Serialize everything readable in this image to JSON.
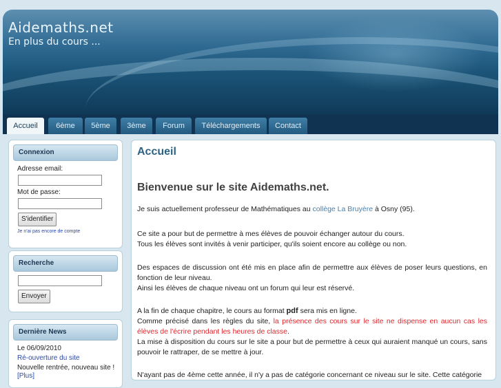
{
  "header": {
    "site_title": "Aidemaths.net",
    "slogan": "En plus du cours ..."
  },
  "nav": {
    "tabs": [
      "Accueil",
      "6ème",
      "5ème",
      "3ème",
      "Forum",
      "Téléchargements",
      "Contact"
    ]
  },
  "sidebar": {
    "connexion": {
      "title": "Connexion",
      "email_label": "Adresse email:",
      "email_value": "",
      "password_label": "Mot de passe:",
      "password_value": "",
      "login_button": "S'identifier",
      "signup_link": "Je n'ai pas encore de compte"
    },
    "recherche": {
      "title": "Recherche",
      "query_value": "",
      "search_button": "Envoyer"
    },
    "news": {
      "title": "Dernière News",
      "date_line": "Le 06/09/2010",
      "headline": "Ré-ouverture du site",
      "summary": "Nouvelle rentrée, nouveau site !",
      "more_link": "[Plus]"
    }
  },
  "main": {
    "title": "Accueil",
    "welcome": "Bienvenue sur le site Aidemaths.net.",
    "p1_before": "Je suis actuellement professeur de Mathématiques au ",
    "p1_link": "collège La Bruyère",
    "p1_after": " à Osny (95).",
    "p2_line1": "Ce site a pour but de permettre à mes élèves de pouvoir échanger autour du cours.",
    "p2_line2": "Tous les élèves sont invités à venir participer, qu'ils soient encore au collège ou non.",
    "p3_line1": "Des espaces de discussion ont été mis en place afin de permettre aux élèves de poser leurs questions, en fonction de leur niveau.",
    "p3_line2": "Ainsi les élèves de chaque niveau ont un forum qui leur est réservé.",
    "p4_a": "A la fin de chaque chapitre, le cours au format ",
    "p4_pdf": "pdf",
    "p4_b": " sera mis en ligne.",
    "p4_c": "Comme précisé dans les règles du site, ",
    "p4_red": "la présence des cours sur le site ne dispense en aucun cas les élèves de l'écrire pendant les heures de classe",
    "p4_dot": ".",
    "p4_d": "La mise à disposition du cours sur le site a pour but de permettre à ceux qui auraient manqué un cours, sans pouvoir le rattraper, de se mettre à jour.",
    "p5": "N'ayant pas de 4ème cette année, il n'y a pas de catégorie concernant ce niveau sur le site. Cette catégorie"
  }
}
